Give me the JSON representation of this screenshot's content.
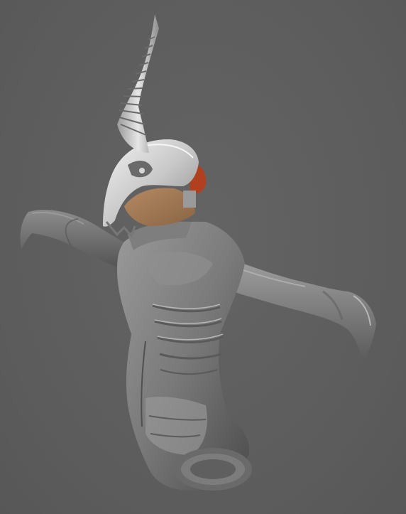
{
  "viewport": {
    "background_color": "#5e5e5e",
    "model_color": "#8a8a8a",
    "mask_color": "#c8c8c8",
    "skin_color": "#a07a58",
    "accent_color": "#b04020"
  },
  "model": {
    "parts": [
      {
        "name": "horn",
        "icon": "horn-shape"
      },
      {
        "name": "skull-mask",
        "icon": "mask-shape"
      },
      {
        "name": "head-skin",
        "icon": "skin-patch"
      },
      {
        "name": "torso",
        "icon": "torso-shape"
      },
      {
        "name": "left-arm",
        "icon": "arm-shape"
      },
      {
        "name": "right-arm",
        "icon": "arm-shape"
      }
    ]
  }
}
